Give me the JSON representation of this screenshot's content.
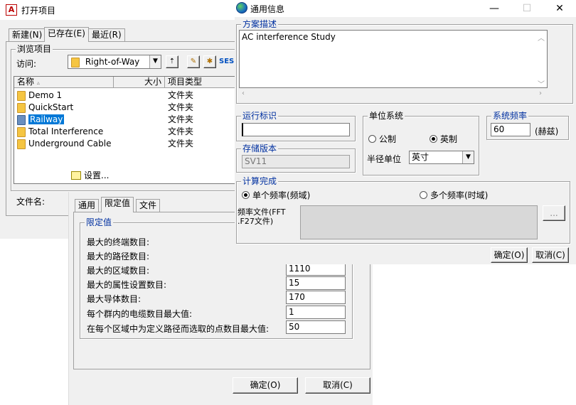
{
  "open_project": {
    "title": "打开项目",
    "tabs": [
      "新建(N)",
      "已存在(E)",
      "最近(R)"
    ],
    "browse_group": "浏览项目",
    "look_in_label": "访问:",
    "look_in_value": "Right-of-Way",
    "columns": [
      "名称",
      "大小",
      "项目类型"
    ],
    "rows": [
      {
        "name": "Demo 1",
        "type": "文件夹"
      },
      {
        "name": "QuickStart",
        "type": "文件夹"
      },
      {
        "name": "Railway",
        "type": "文件夹"
      },
      {
        "name": "Total Interference",
        "type": "文件夹"
      },
      {
        "name": "Underground Cable",
        "type": "文件夹"
      }
    ],
    "settings_label": "设置...",
    "filename_label": "文件名:"
  },
  "settings": {
    "tabs": [
      "通用",
      "限定值",
      "文件"
    ],
    "group_title": "限定值",
    "items": [
      {
        "label": "最大的终端数目:",
        "value": ""
      },
      {
        "label": "最大的路径数目:",
        "value": ""
      },
      {
        "label": "最大的区域数目:",
        "value": "1110"
      },
      {
        "label": "最大的属性设置数目:",
        "value": "15"
      },
      {
        "label": "最大导体数目:",
        "value": "170"
      },
      {
        "label": "每个群内的电缆数目最大值:",
        "value": "1"
      },
      {
        "label": "在每个区域中为定义路径而选取的点数目最大值:",
        "value": "50"
      }
    ],
    "ok": "确定(O)",
    "cancel": "取消(C)"
  },
  "general_info": {
    "title": "通用信息",
    "desc_group": "方案描述",
    "desc_text": "AC interference Study",
    "run_id_group": "运行标识",
    "run_id_value": "",
    "version_group": "存储版本",
    "version_value": "SV11",
    "unit_group": "单位系统",
    "unit_metric": "公制",
    "unit_imperial": "英制",
    "radius_label": "半径单位",
    "radius_value": "英寸",
    "freq_group": "系统频率",
    "freq_value": "60",
    "freq_unit": "(赫兹)",
    "calc_group": "计算完成",
    "calc_single": "单个频率(频域)",
    "calc_multi": "多个频率(时域)",
    "freq_file_label": "频率文件(FFT .F27文件)",
    "browse_btn": "...",
    "ok": "确定(O)",
    "cancel": "取消(C)"
  }
}
